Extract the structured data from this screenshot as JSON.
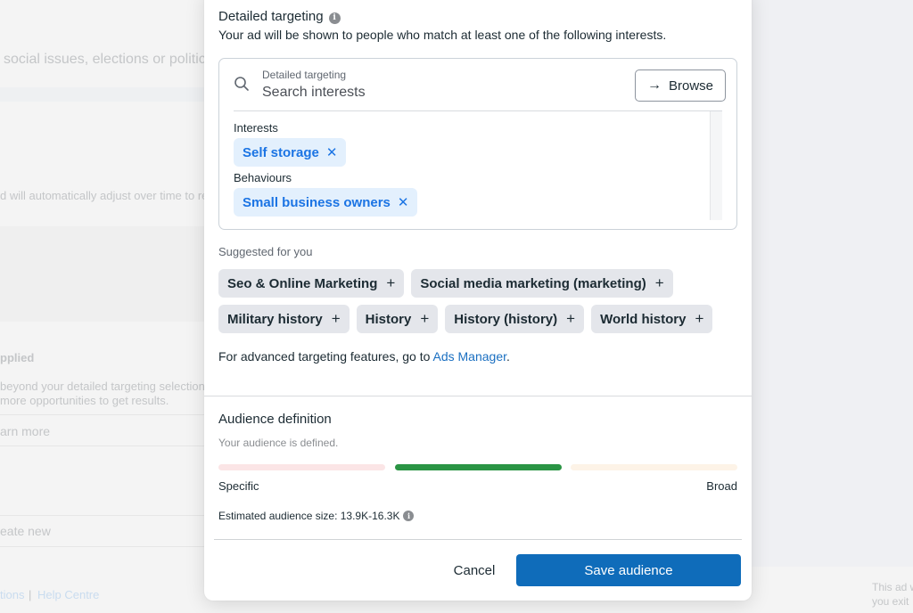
{
  "background": {
    "line1": "social issues, elections or politics",
    "line2": "d will automatically adjust over time to re",
    "line3": "pplied",
    "line4a": "beyond your detailed targeting selection",
    "line4b": "more opportunities to get results.",
    "learn_more": "arn more",
    "create_new": "eate new",
    "footer_link1": "tions",
    "footer_sep": "|",
    "footer_link2": "Help Centre",
    "right_text1": "This ad w",
    "right_text2": "you exit"
  },
  "detailed_targeting": {
    "title": "Detailed targeting",
    "info_icon": "i",
    "subtitle": "Your ad will be shown to people who match at least one of the following interests.",
    "search": {
      "label": "Detailed targeting",
      "placeholder": "Search interests",
      "value": ""
    },
    "browse_label": "Browse",
    "browse_icon": "→",
    "groups": [
      {
        "label": "Interests",
        "items": [
          {
            "label": "Self storage",
            "remove_icon": "✕"
          }
        ]
      },
      {
        "label": "Behaviours",
        "items": [
          {
            "label": "Small business owners",
            "remove_icon": "✕"
          }
        ]
      }
    ]
  },
  "suggested": {
    "label": "Suggested for you",
    "add_icon": "+",
    "row1": [
      "Seo & Online Marketing",
      "Social media marketing (marketing)"
    ],
    "row2": [
      "Military history",
      "History",
      "History (history)",
      "World history"
    ]
  },
  "advanced": {
    "prefix": "For advanced targeting features, go to ",
    "link": "Ads Manager",
    "suffix": "."
  },
  "audience": {
    "title": "Audience definition",
    "status": "Your audience is defined.",
    "meter_state": "defined",
    "meter_active_segment": 2,
    "meter_segments": 3,
    "specific_label": "Specific",
    "broad_label": "Broad",
    "estimate_label": "Estimated audience size: 13.9K-16.3K",
    "colors": {
      "specific": "#fbe5e6",
      "defined": "#2a9444",
      "broad": "#fdf3e7"
    }
  },
  "footer": {
    "cancel_label": "Cancel",
    "save_label": "Save audience"
  },
  "colors": {
    "primary": "#0f6cba",
    "chip_selected_bg": "#e3f0fd",
    "chip_selected_text": "#1b74e4",
    "chip_suggested_bg": "#e4e6eb",
    "link": "#1a6fc1"
  }
}
